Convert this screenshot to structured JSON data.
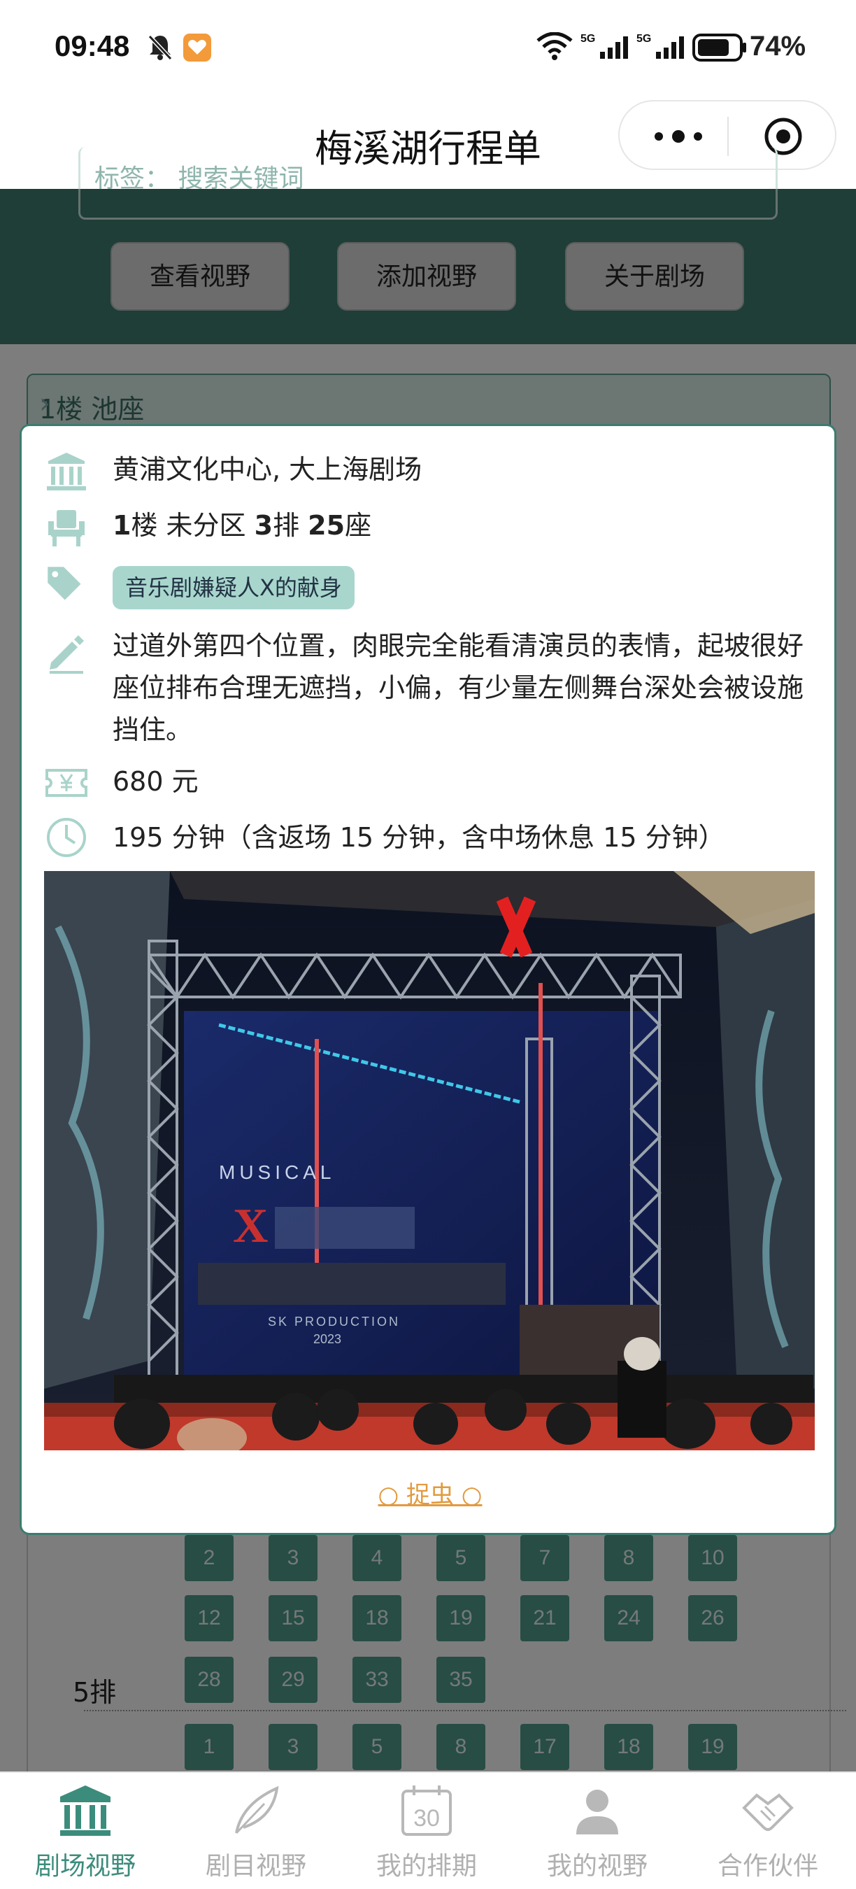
{
  "status_bar": {
    "time": "09:48",
    "battery_percent": "74%",
    "network_1": "5G",
    "network_2": "5G"
  },
  "title_bar": {
    "title": "梅溪湖行程单"
  },
  "header": {
    "search_placeholder_fragment": "标签： 搜索关键词",
    "buttons": [
      "查看视野",
      "添加视野",
      "关于剧场"
    ]
  },
  "floor_selector": {
    "label": "1楼 池座"
  },
  "seat_detail": {
    "theater": "黄浦文化中心, 大上海剧场",
    "seat": {
      "floor_num": "1",
      "floor_unit": "楼 未分区 ",
      "row_num": "3",
      "row_unit": "排 ",
      "seat_num": "25",
      "seat_unit": "座"
    },
    "tag": "音乐剧嫌疑人X的献身",
    "description": "过道外第四个位置，肉眼完全能看清演员的表情，起坡很好座位排布合理无遮挡，小偏，有少量左侧舞台深处会被设施挡住。",
    "price": "680 元",
    "duration": "195 分钟（含返场 15 分钟，含中场休息 15 分钟）",
    "photo_caption_musical": "MUSICAL",
    "photo_caption_production": "SK PRODUCTION",
    "photo_caption_year": "2023",
    "bug_report": "○ 捉虫 ○"
  },
  "seat_map": {
    "row_label": "5排",
    "rows": [
      [
        "2",
        "3",
        "4",
        "5",
        "7",
        "8",
        "10"
      ],
      [
        "12",
        "15",
        "18",
        "19",
        "21",
        "24",
        "26"
      ],
      [
        "28",
        "29",
        "33",
        "35"
      ],
      [
        "1",
        "3",
        "5",
        "8",
        "17",
        "18",
        "19"
      ]
    ]
  },
  "tab_bar": {
    "items": [
      "剧场视野",
      "剧目视野",
      "我的排期",
      "我的视野",
      "合作伙伴"
    ],
    "active_index": 0
  },
  "colors": {
    "accent": "#3c7c6f",
    "tag_bg": "#a8d6cd",
    "bug_link": "#e29a3e"
  }
}
